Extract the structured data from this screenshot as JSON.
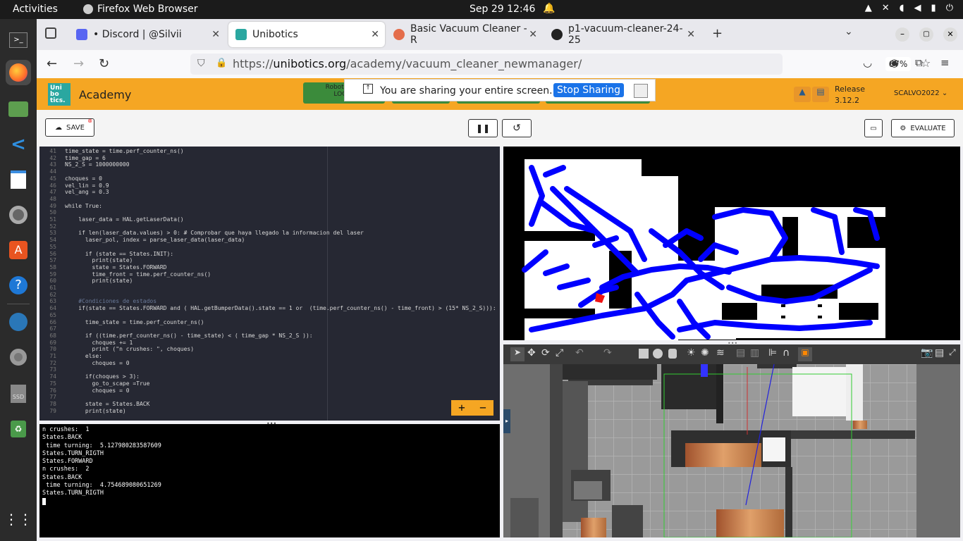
{
  "topbar": {
    "activities": "Activities",
    "app_name": "Firefox Web Browser",
    "clock": "Sep 29  12:46"
  },
  "dock": {
    "icons": [
      "terminal-icon",
      "firefox-icon",
      "files-icon",
      "vscode-icon",
      "text-editor-icon",
      "settings-icon",
      "app-center-icon",
      "help-icon",
      "disks-icon",
      "optical-drive-icon",
      "ssd-icon",
      "trash-icon",
      "show-apps-icon"
    ]
  },
  "browser": {
    "tabs": [
      {
        "label": "• Discord | @Silvii"
      },
      {
        "label": "Unibotics"
      },
      {
        "label": "Basic Vacuum Cleaner - R"
      },
      {
        "label": "p1-vacuum-cleaner-24-25"
      }
    ],
    "url_prefix": "https://",
    "url_domain": "unibotics.org",
    "url_path": "/academy/vacuum_cleaner_newmanager/",
    "zoom": "67%"
  },
  "header": {
    "logo_text": "Uni bo tics.",
    "academy": "Academy",
    "share_text": "You are sharing your entire screen.",
    "stop_sharing": "Stop Sharing",
    "hidden_btn_line1": "Robotics Ba",
    "hidden_btn_line2": "LOCAL",
    "release_label": "Release",
    "release_version": "3.12.2",
    "username": "SCALVO2022"
  },
  "toolbar": {
    "save": "SAVE",
    "evaluate": "EVALUATE"
  },
  "editor": {
    "lines": [
      {
        "n": "41",
        "t": "time_state = time.perf_counter_ns()"
      },
      {
        "n": "42",
        "t": "time_gap = 6"
      },
      {
        "n": "43",
        "t": "NS_2_S = 1000000000"
      },
      {
        "n": "44",
        "t": ""
      },
      {
        "n": "45",
        "t": "choques = 0"
      },
      {
        "n": "46",
        "t": "vel_lin = 0.9"
      },
      {
        "n": "47",
        "t": "vel_ang = 0.3"
      },
      {
        "n": "48",
        "t": ""
      },
      {
        "n": "49",
        "t": "while True:"
      },
      {
        "n": "50",
        "t": ""
      },
      {
        "n": "51",
        "t": "    laser_data = HAL.getLaserData()"
      },
      {
        "n": "52",
        "t": ""
      },
      {
        "n": "53",
        "t": "    if len(laser_data.values) > 0: # Comprobar que haya llegado la informacion del laser"
      },
      {
        "n": "54",
        "t": "      laser_pol, index = parse_laser_data(laser_data)"
      },
      {
        "n": "55",
        "t": ""
      },
      {
        "n": "56",
        "t": "      if (state == States.INIT):"
      },
      {
        "n": "57",
        "t": "        print(state)"
      },
      {
        "n": "58",
        "t": "        state = States.FORWARD"
      },
      {
        "n": "59",
        "t": "        time_front = time.perf_counter_ns()"
      },
      {
        "n": "60",
        "t": "        print(state)"
      },
      {
        "n": "61",
        "t": ""
      },
      {
        "n": "62",
        "t": ""
      },
      {
        "n": "63",
        "t": "    #Condiciones de estados"
      },
      {
        "n": "64",
        "t": "    if(state == States.FORWARD and ( HAL.getBumperData().state == 1 or  (time.perf_counter_ns() - time_front) > (15* NS_2_S))):"
      },
      {
        "n": "65",
        "t": ""
      },
      {
        "n": "66",
        "t": "      time_state = time.perf_counter_ns()"
      },
      {
        "n": "67",
        "t": ""
      },
      {
        "n": "68",
        "t": "      if ((time.perf_counter_ns() - time_state) < ( time_gap * NS_2_S )):"
      },
      {
        "n": "69",
        "t": "        choques += 1"
      },
      {
        "n": "70",
        "t": "        print (\"n crushes: \", choques)"
      },
      {
        "n": "71",
        "t": "      else:"
      },
      {
        "n": "72",
        "t": "        choques = 0"
      },
      {
        "n": "73",
        "t": ""
      },
      {
        "n": "74",
        "t": "      if(choques > 3):"
      },
      {
        "n": "75",
        "t": "        go_to_scape =True"
      },
      {
        "n": "76",
        "t": "        choques = 0"
      },
      {
        "n": "77",
        "t": ""
      },
      {
        "n": "78",
        "t": "      state = States.BACK"
      },
      {
        "n": "79",
        "t": "      print(state)"
      }
    ],
    "plus": "+",
    "minus": "−"
  },
  "console": {
    "lines": [
      "n crushes:  1",
      "States.BACK",
      " time turning:  5.127980283587609",
      "States.TURN_RIGTH",
      "States.FORWARD",
      "n crushes:  2",
      "States.BACK",
      " time turning:  4.754689080651269",
      "States.TURN_RIGTH"
    ]
  }
}
